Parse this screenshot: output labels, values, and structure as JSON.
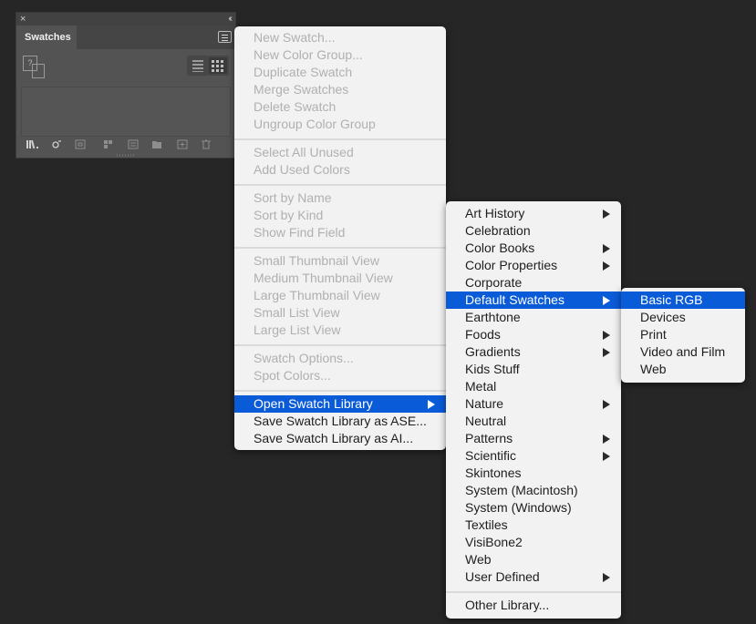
{
  "panel": {
    "close_icon": "×",
    "collapse_icon": "‹‹",
    "tab_label": "Swatches",
    "none_swatch": "?"
  },
  "main_menu": {
    "items": [
      {
        "label": "New Swatch...",
        "state": "disabled"
      },
      {
        "label": "New Color Group...",
        "state": "disabled"
      },
      {
        "label": "Duplicate Swatch",
        "state": "disabled"
      },
      {
        "label": "Merge Swatches",
        "state": "disabled"
      },
      {
        "label": "Delete Swatch",
        "state": "disabled"
      },
      {
        "label": "Ungroup Color Group",
        "state": "disabled"
      },
      {
        "label": "Select All Unused",
        "state": "disabled"
      },
      {
        "label": "Add Used Colors",
        "state": "disabled"
      },
      {
        "label": "Sort by Name",
        "state": "disabled"
      },
      {
        "label": "Sort by Kind",
        "state": "disabled"
      },
      {
        "label": "Show Find Field",
        "state": "disabled"
      },
      {
        "label": "Small Thumbnail View",
        "state": "disabled"
      },
      {
        "label": "Medium Thumbnail View",
        "state": "disabled"
      },
      {
        "label": "Large Thumbnail View",
        "state": "disabled"
      },
      {
        "label": "Small List View",
        "state": "disabled"
      },
      {
        "label": "Large List View",
        "state": "disabled"
      },
      {
        "label": "Swatch Options...",
        "state": "disabled"
      },
      {
        "label": "Spot Colors...",
        "state": "disabled"
      },
      {
        "label": "Open Swatch Library",
        "state": "highlighted",
        "submenu": true
      },
      {
        "label": "Save Swatch Library as ASE...",
        "state": "enabled"
      },
      {
        "label": "Save Swatch Library as AI...",
        "state": "enabled"
      }
    ]
  },
  "library_menu": {
    "items": [
      {
        "label": "Art History",
        "submenu": true
      },
      {
        "label": "Celebration"
      },
      {
        "label": "Color Books",
        "submenu": true
      },
      {
        "label": "Color Properties",
        "submenu": true
      },
      {
        "label": "Corporate"
      },
      {
        "label": "Default Swatches",
        "submenu": true,
        "state": "highlighted"
      },
      {
        "label": "Earthtone"
      },
      {
        "label": "Foods",
        "submenu": true
      },
      {
        "label": "Gradients",
        "submenu": true
      },
      {
        "label": "Kids Stuff"
      },
      {
        "label": "Metal"
      },
      {
        "label": "Nature",
        "submenu": true
      },
      {
        "label": "Neutral"
      },
      {
        "label": "Patterns",
        "submenu": true
      },
      {
        "label": "Scientific",
        "submenu": true
      },
      {
        "label": "Skintones"
      },
      {
        "label": "System (Macintosh)"
      },
      {
        "label": "System (Windows)"
      },
      {
        "label": "Textiles"
      },
      {
        "label": "VisiBone2"
      },
      {
        "label": "Web"
      },
      {
        "label": "User Defined",
        "submenu": true
      },
      {
        "label": "Other Library..."
      }
    ]
  },
  "default_swatches_menu": {
    "items": [
      {
        "label": "Basic RGB",
        "state": "highlighted"
      },
      {
        "label": "Devices"
      },
      {
        "label": "Print"
      },
      {
        "label": "Video and Film"
      },
      {
        "label": "Web"
      }
    ]
  },
  "colors": {
    "highlight": "#0a5bd8",
    "menu_bg": "#f2f2f2",
    "disabled_text": "#b0b0b0",
    "desktop_bg": "#262626"
  }
}
